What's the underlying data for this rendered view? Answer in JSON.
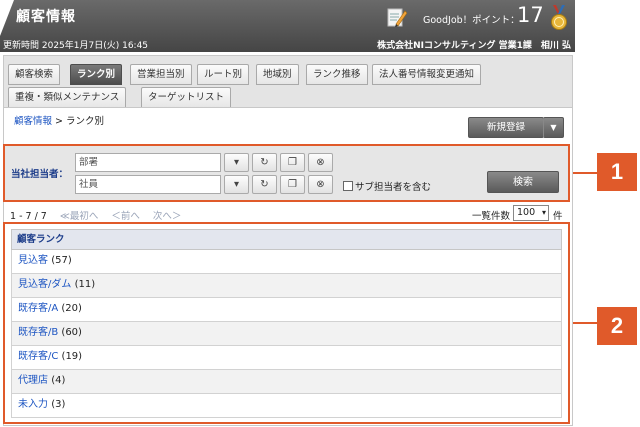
{
  "header": {
    "title": "顧客情報",
    "points_label": "GoodJob！ポイント：",
    "points_value": "17",
    "updated": "更新時間 2025年1月7日(火) 16:45",
    "company": "株式会社NIコンサルティング 営業1課　相川 弘"
  },
  "tabs": [
    {
      "label": "顧客検索",
      "active": false
    },
    {
      "label": "ランク別",
      "active": true
    },
    {
      "label": "営業担当別",
      "active": false
    },
    {
      "label": "ルート別",
      "active": false
    },
    {
      "label": "地域別",
      "active": false
    },
    {
      "label": "ランク推移",
      "active": false
    },
    {
      "label": "法人番号情報変更通知",
      "active": false
    },
    {
      "label": "重複・類似メンテナンス",
      "active": false
    },
    {
      "label": "ターゲットリスト",
      "active": false
    }
  ],
  "breadcrumb": {
    "root": "顧客情報",
    "separator": " > ",
    "current": "ランク別"
  },
  "actions": {
    "new_label": "新規登録",
    "caret": "▼"
  },
  "search": {
    "label": "当社担当者：",
    "dept_value": "部署",
    "staff_value": "社員",
    "sub_label": "サブ担当者を含む",
    "search_label": "検索"
  },
  "pager": {
    "range": "1 - 7 / 7",
    "first": "≪最初へ",
    "prev": "＜前へ",
    "next": "次へ＞",
    "per_page_label": "一覧件数",
    "per_page_value": "100",
    "per_page_unit": "件"
  },
  "list": {
    "header": "顧客ランク",
    "rows": [
      {
        "name": "見込客",
        "count": "(57)"
      },
      {
        "name": "見込客/ダム",
        "count": "(11)"
      },
      {
        "name": "既存客/A",
        "count": "(20)"
      },
      {
        "name": "既存客/B",
        "count": "(60)"
      },
      {
        "name": "既存客/C",
        "count": "(19)"
      },
      {
        "name": "代理店",
        "count": "(4)"
      },
      {
        "name": "未入力",
        "count": "(3)"
      }
    ]
  },
  "callouts": [
    "1",
    "2"
  ],
  "colors": {
    "accent": "#e05a2a",
    "link": "#1d55c2",
    "header_bg": "#555555"
  }
}
